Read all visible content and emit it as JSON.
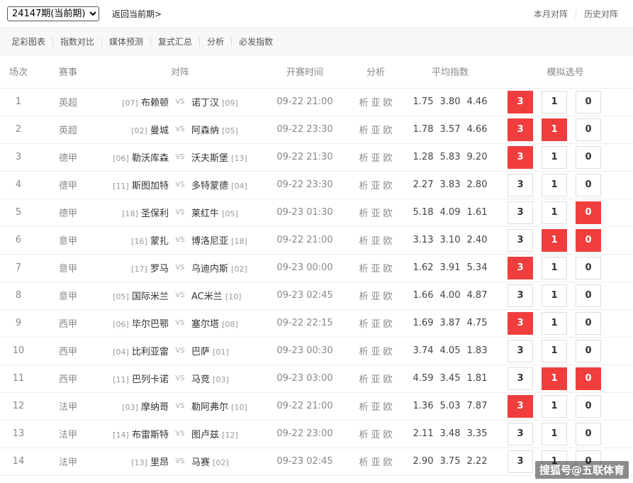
{
  "header": {
    "period": "24147期(当前期)",
    "back": "返回当前期>",
    "month_matchups": "本月对阵",
    "history_matchups": "历史对阵"
  },
  "tabs": [
    "足彩图表",
    "指数对比",
    "媒体预测",
    "复式汇总",
    "分析",
    "必发指数"
  ],
  "columns": {
    "no": "场次",
    "league": "赛事",
    "match": "对阵",
    "time": "开赛时间",
    "analysis": "分析",
    "odds": "平均指数",
    "picks": "模拟选号"
  },
  "vs_label": "VS",
  "analysis_links": [
    "析",
    "亚",
    "欧"
  ],
  "pick_labels": [
    "3",
    "1",
    "0"
  ],
  "matches": [
    {
      "no": "1",
      "league": "英超",
      "home_rank": "[07]",
      "home": "布赖顿",
      "away": "诺丁汉",
      "away_rank": "[09]",
      "time": "09-22 21:00",
      "odds": [
        "1.75",
        "3.80",
        "4.46"
      ],
      "picks": [
        true,
        false,
        false
      ]
    },
    {
      "no": "2",
      "league": "英超",
      "home_rank": "[02]",
      "home": "曼城",
      "away": "阿森纳",
      "away_rank": "[05]",
      "time": "09-22 23:30",
      "odds": [
        "1.78",
        "3.57",
        "4.66"
      ],
      "picks": [
        true,
        true,
        false
      ]
    },
    {
      "no": "3",
      "league": "德甲",
      "home_rank": "[06]",
      "home": "勒沃库森",
      "away": "沃夫斯堡",
      "away_rank": "[13]",
      "time": "09-22 21:30",
      "odds": [
        "1.28",
        "5.83",
        "9.20"
      ],
      "picks": [
        true,
        false,
        false
      ]
    },
    {
      "no": "4",
      "league": "德甲",
      "home_rank": "[11]",
      "home": "斯图加特",
      "away": "多特蒙德",
      "away_rank": "[04]",
      "time": "09-22 23:30",
      "odds": [
        "2.27",
        "3.83",
        "2.80"
      ],
      "picks": [
        false,
        false,
        false
      ]
    },
    {
      "no": "5",
      "league": "德甲",
      "home_rank": "[18]",
      "home": "圣保利",
      "away": "莱红牛",
      "away_rank": "[05]",
      "time": "09-23 01:30",
      "odds": [
        "5.18",
        "4.09",
        "1.61"
      ],
      "picks": [
        false,
        false,
        true
      ]
    },
    {
      "no": "6",
      "league": "意甲",
      "home_rank": "[16]",
      "home": "蒙扎",
      "away": "博洛尼亚",
      "away_rank": "[18]",
      "time": "09-22 21:00",
      "odds": [
        "3.13",
        "3.10",
        "2.40"
      ],
      "picks": [
        false,
        true,
        true
      ]
    },
    {
      "no": "7",
      "league": "意甲",
      "home_rank": "[17]",
      "home": "罗马",
      "away": "乌迪内斯",
      "away_rank": "[02]",
      "time": "09-23 00:00",
      "odds": [
        "1.62",
        "3.91",
        "5.34"
      ],
      "picks": [
        true,
        false,
        false
      ]
    },
    {
      "no": "8",
      "league": "意甲",
      "home_rank": "[05]",
      "home": "国际米兰",
      "away": "AC米兰",
      "away_rank": "[10]",
      "time": "09-23 02:45",
      "odds": [
        "1.66",
        "4.00",
        "4.87"
      ],
      "picks": [
        false,
        false,
        false
      ]
    },
    {
      "no": "9",
      "league": "西甲",
      "home_rank": "[06]",
      "home": "毕尔巴鄂",
      "away": "塞尔塔",
      "away_rank": "[08]",
      "time": "09-22 22:15",
      "odds": [
        "1.69",
        "3.87",
        "4.75"
      ],
      "picks": [
        true,
        false,
        false
      ]
    },
    {
      "no": "10",
      "league": "西甲",
      "home_rank": "[04]",
      "home": "比利亚雷",
      "away": "巴萨",
      "away_rank": "[01]",
      "time": "09-23 00:30",
      "odds": [
        "3.74",
        "4.05",
        "1.83"
      ],
      "picks": [
        false,
        false,
        false
      ]
    },
    {
      "no": "11",
      "league": "西甲",
      "home_rank": "[11]",
      "home": "巴列卡诺",
      "away": "马竞",
      "away_rank": "[03]",
      "time": "09-23 03:00",
      "odds": [
        "4.59",
        "3.45",
        "1.81"
      ],
      "picks": [
        false,
        true,
        true
      ]
    },
    {
      "no": "12",
      "league": "法甲",
      "home_rank": "[03]",
      "home": "摩纳哥",
      "away": "勒阿弗尔",
      "away_rank": "[10]",
      "time": "09-22 21:00",
      "odds": [
        "1.36",
        "5.03",
        "7.87"
      ],
      "picks": [
        true,
        false,
        false
      ]
    },
    {
      "no": "13",
      "league": "法甲",
      "home_rank": "[14]",
      "home": "布雷斯特",
      "away": "图卢兹",
      "away_rank": "[12]",
      "time": "09-22 23:00",
      "odds": [
        "2.11",
        "3.48",
        "3.35"
      ],
      "picks": [
        false,
        false,
        false
      ]
    },
    {
      "no": "14",
      "league": "法甲",
      "home_rank": "[13]",
      "home": "里昂",
      "away": "马赛",
      "away_rank": "[02]",
      "time": "09-23 02:45",
      "odds": [
        "2.90",
        "3.75",
        "2.22"
      ],
      "picks": [
        false,
        false,
        false
      ]
    }
  ],
  "watermark": "搜狐号@五联体育",
  "colors": {
    "accent_red": "#f03e3e"
  }
}
